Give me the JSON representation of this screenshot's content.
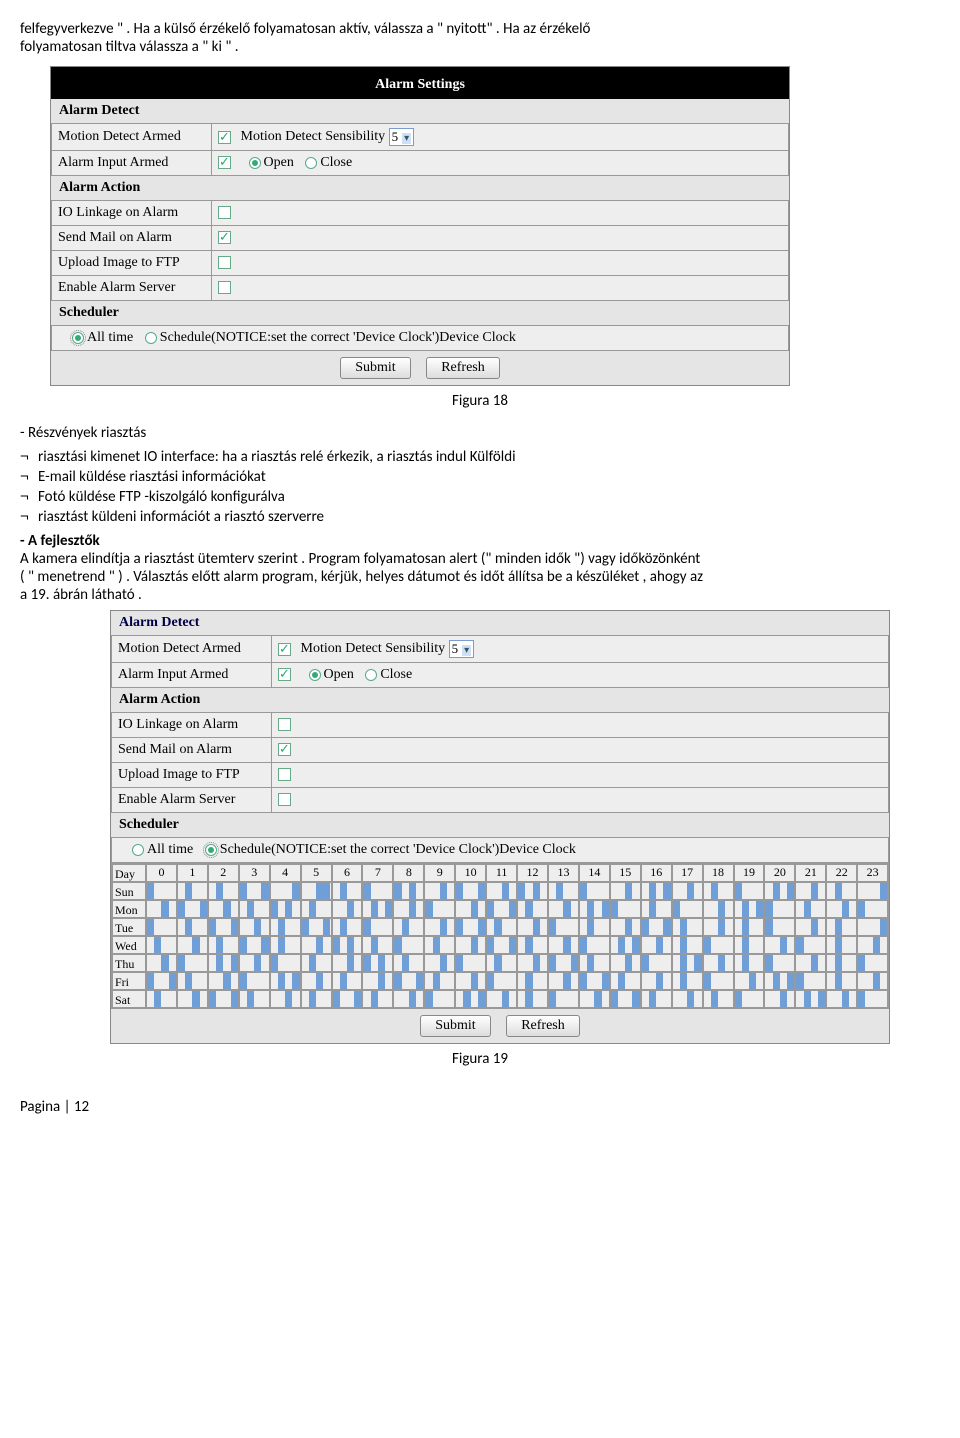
{
  "intro": {
    "line1a": "felfegyverkezve \" . Ha a külső érzékelő folyamatosan aktív, válassza a \" nyitott\" . Ha az érzékelő",
    "line1b": "folyamatosan tiltva válassza a \" ki \" ."
  },
  "panel1": {
    "title": "Alarm Settings",
    "alarm_detect_title": "Alarm Detect",
    "motion_detect_armed": "Motion Detect Armed",
    "motion_sensibility": "Motion Detect Sensibility",
    "sensibility_value": "5",
    "alarm_input_armed": "Alarm Input Armed",
    "open": "Open",
    "close": "Close",
    "alarm_action_title": "Alarm Action",
    "io_linkage": "IO Linkage on Alarm",
    "send_mail": "Send Mail on Alarm",
    "upload_ftp": "Upload Image to FTP",
    "enable_server": "Enable Alarm Server",
    "scheduler": "Scheduler",
    "all_time": "All time",
    "schedule_notice": "Schedule(NOTICE:set the correct 'Device Clock')Device Clock",
    "submit": "Submit",
    "refresh": "Refresh"
  },
  "caption1": "Figura 18",
  "section_title": "- Részvények riasztás",
  "bullets": {
    "b1": "riasztási kimenet IO interface: ha a riasztás relé érkezik, a riasztás indul Külföldi",
    "b2": "E-mail küldése riasztási információkat",
    "b3": "Fotó küldése FTP -kiszolgáló konfigurálva",
    "b4": "riasztást küldeni információt a riasztó szerverre"
  },
  "dev_title": "- A fejlesztők",
  "para2": {
    "l1": "A kamera elindítja a riasztást ütemterv szerint . Program folyamatosan alert (\" minden idők \") vagy időközönként",
    "l2": "( \" menetrend \" ) . Választás előtt alarm program, kérjük, helyes dátumot és időt állítsa be a készüléket , ahogy az",
    "l3": "a 19. ábrán látható ."
  },
  "panel2": {
    "alarm_detect_title": "Alarm Detect",
    "motion_detect_armed": "Motion Detect Armed",
    "motion_sensibility": "Motion Detect Sensibility",
    "sensibility_value": "5",
    "alarm_input_armed": "Alarm Input Armed",
    "open": "Open",
    "close": "Close",
    "alarm_action_title": "Alarm Action",
    "io_linkage": "IO Linkage on Alarm",
    "send_mail": "Send Mail on Alarm",
    "upload_ftp": "Upload Image to FTP",
    "enable_server": "Enable Alarm Server",
    "scheduler": "Scheduler",
    "all_time": "All time",
    "schedule_notice": "Schedule(NOTICE:set the correct 'Device Clock')Device Clock",
    "day_label": "Day",
    "hours": [
      "0",
      "1",
      "2",
      "3",
      "4",
      "5",
      "6",
      "7",
      "8",
      "9",
      "10",
      "11",
      "12",
      "13",
      "14",
      "15",
      "16",
      "17",
      "18",
      "19",
      "20",
      "21",
      "22",
      "23"
    ],
    "days": [
      "Sun",
      "Mon",
      "Tue",
      "Wed",
      "Thu",
      "Fri",
      "Sat"
    ],
    "submit": "Submit",
    "refresh": "Refresh"
  },
  "caption2": "Figura 19",
  "footer": "Pagina | 12",
  "chart_data": {
    "type": "table",
    "note": "Approximate scheduler pattern (4 quarter-hour segments per hour, 1=on).",
    "hours": [
      "0",
      "1",
      "2",
      "3",
      "4",
      "5",
      "6",
      "7",
      "8",
      "9",
      "10",
      "11",
      "12",
      "13",
      "14",
      "15",
      "16",
      "17",
      "18",
      "19",
      "20",
      "21",
      "22",
      "23"
    ],
    "days": [
      "Sun",
      "Mon",
      "Tue",
      "Wed",
      "Thu",
      "Fri",
      "Sat"
    ],
    "pattern": {
      "Sun": [
        [
          1,
          0,
          0,
          0
        ],
        [
          0,
          1,
          0,
          0
        ],
        [
          0,
          1,
          0,
          0
        ],
        [
          1,
          0,
          0,
          1
        ],
        [
          0,
          0,
          0,
          1
        ],
        [
          0,
          0,
          1,
          1
        ],
        [
          0,
          1,
          0,
          0
        ],
        [
          1,
          0,
          0,
          0
        ],
        [
          1,
          0,
          1,
          0
        ],
        [
          0,
          0,
          1,
          0
        ],
        [
          1,
          0,
          0,
          1
        ],
        [
          0,
          0,
          1,
          0
        ],
        [
          1,
          0,
          1,
          0
        ],
        [
          0,
          1,
          0,
          0
        ],
        [
          1,
          0,
          0,
          0
        ],
        [
          0,
          0,
          1,
          0
        ],
        [
          0,
          1,
          0,
          1
        ],
        [
          0,
          0,
          1,
          0
        ],
        [
          0,
          1,
          0,
          0
        ],
        [
          1,
          0,
          0,
          0
        ],
        [
          0,
          1,
          0,
          1
        ],
        [
          0,
          0,
          1,
          0
        ],
        [
          0,
          1,
          0,
          0
        ],
        [
          0,
          0,
          0,
          1
        ]
      ],
      "Mon": [
        [
          0,
          0,
          1,
          0
        ],
        [
          1,
          0,
          0,
          1
        ],
        [
          0,
          0,
          1,
          0
        ],
        [
          0,
          1,
          0,
          0
        ],
        [
          1,
          0,
          1,
          0
        ],
        [
          0,
          1,
          0,
          0
        ],
        [
          0,
          0,
          1,
          0
        ],
        [
          0,
          1,
          0,
          1
        ],
        [
          0,
          0,
          1,
          0
        ],
        [
          1,
          0,
          0,
          0
        ],
        [
          0,
          0,
          1,
          0
        ],
        [
          1,
          0,
          0,
          1
        ],
        [
          0,
          1,
          0,
          0
        ],
        [
          0,
          0,
          1,
          0
        ],
        [
          0,
          1,
          0,
          1
        ],
        [
          1,
          0,
          0,
          0
        ],
        [
          0,
          1,
          0,
          0
        ],
        [
          1,
          0,
          0,
          0
        ],
        [
          0,
          0,
          1,
          0
        ],
        [
          0,
          1,
          0,
          1
        ],
        [
          1,
          0,
          0,
          0
        ],
        [
          0,
          1,
          0,
          0
        ],
        [
          0,
          0,
          1,
          0
        ],
        [
          1,
          0,
          0,
          0
        ]
      ],
      "Tue": [
        [
          1,
          0,
          0,
          0
        ],
        [
          0,
          1,
          0,
          0
        ],
        [
          1,
          0,
          0,
          1
        ],
        [
          0,
          0,
          1,
          0
        ],
        [
          0,
          1,
          0,
          0
        ],
        [
          1,
          0,
          0,
          1
        ],
        [
          0,
          1,
          0,
          0
        ],
        [
          1,
          0,
          0,
          0
        ],
        [
          0,
          1,
          0,
          0
        ],
        [
          0,
          0,
          1,
          0
        ],
        [
          1,
          0,
          0,
          1
        ],
        [
          0,
          1,
          0,
          0
        ],
        [
          0,
          0,
          1,
          0
        ],
        [
          1,
          0,
          0,
          0
        ],
        [
          0,
          1,
          0,
          0
        ],
        [
          0,
          0,
          1,
          0
        ],
        [
          1,
          0,
          0,
          1
        ],
        [
          0,
          1,
          0,
          0
        ],
        [
          0,
          0,
          1,
          0
        ],
        [
          0,
          1,
          0,
          0
        ],
        [
          1,
          0,
          0,
          0
        ],
        [
          0,
          0,
          1,
          0
        ],
        [
          0,
          1,
          0,
          0
        ],
        [
          0,
          0,
          0,
          1
        ]
      ],
      "Wed": [
        [
          0,
          1,
          0,
          0
        ],
        [
          0,
          0,
          1,
          0
        ],
        [
          0,
          1,
          0,
          0
        ],
        [
          1,
          0,
          0,
          1
        ],
        [
          0,
          1,
          0,
          0
        ],
        [
          0,
          0,
          1,
          0
        ],
        [
          1,
          0,
          1,
          0
        ],
        [
          0,
          1,
          0,
          0
        ],
        [
          1,
          0,
          0,
          0
        ],
        [
          0,
          1,
          0,
          0
        ],
        [
          0,
          0,
          1,
          0
        ],
        [
          1,
          0,
          0,
          1
        ],
        [
          0,
          1,
          0,
          0
        ],
        [
          0,
          0,
          1,
          0
        ],
        [
          1,
          0,
          0,
          0
        ],
        [
          0,
          1,
          0,
          1
        ],
        [
          0,
          0,
          1,
          0
        ],
        [
          0,
          1,
          0,
          0
        ],
        [
          1,
          0,
          0,
          0
        ],
        [
          0,
          1,
          0,
          0
        ],
        [
          0,
          0,
          1,
          0
        ],
        [
          1,
          0,
          0,
          0
        ],
        [
          0,
          1,
          0,
          0
        ],
        [
          0,
          0,
          1,
          0
        ]
      ],
      "Thu": [
        [
          0,
          0,
          1,
          0
        ],
        [
          1,
          0,
          0,
          0
        ],
        [
          0,
          1,
          0,
          1
        ],
        [
          0,
          0,
          1,
          0
        ],
        [
          1,
          0,
          0,
          0
        ],
        [
          0,
          1,
          0,
          0
        ],
        [
          0,
          0,
          1,
          0
        ],
        [
          1,
          0,
          1,
          0
        ],
        [
          0,
          1,
          0,
          0
        ],
        [
          0,
          0,
          1,
          0
        ],
        [
          1,
          0,
          0,
          0
        ],
        [
          0,
          1,
          0,
          0
        ],
        [
          0,
          0,
          1,
          0
        ],
        [
          1,
          0,
          0,
          1
        ],
        [
          0,
          1,
          0,
          0
        ],
        [
          0,
          0,
          1,
          0
        ],
        [
          1,
          0,
          0,
          0
        ],
        [
          0,
          1,
          0,
          1
        ],
        [
          0,
          0,
          1,
          0
        ],
        [
          0,
          1,
          0,
          0
        ],
        [
          1,
          0,
          0,
          0
        ],
        [
          0,
          0,
          1,
          0
        ],
        [
          0,
          1,
          0,
          0
        ],
        [
          1,
          0,
          0,
          0
        ]
      ],
      "Fri": [
        [
          1,
          0,
          0,
          1
        ],
        [
          0,
          1,
          0,
          0
        ],
        [
          0,
          0,
          1,
          0
        ],
        [
          1,
          0,
          0,
          0
        ],
        [
          0,
          1,
          0,
          1
        ],
        [
          0,
          0,
          1,
          0
        ],
        [
          0,
          1,
          0,
          0
        ],
        [
          0,
          0,
          1,
          0
        ],
        [
          1,
          0,
          0,
          1
        ],
        [
          0,
          1,
          0,
          0
        ],
        [
          0,
          0,
          1,
          0
        ],
        [
          1,
          0,
          0,
          0
        ],
        [
          0,
          1,
          0,
          0
        ],
        [
          0,
          0,
          1,
          0
        ],
        [
          1,
          0,
          0,
          1
        ],
        [
          0,
          1,
          0,
          0
        ],
        [
          0,
          0,
          1,
          0
        ],
        [
          0,
          1,
          0,
          0
        ],
        [
          1,
          0,
          0,
          0
        ],
        [
          0,
          0,
          1,
          0
        ],
        [
          0,
          1,
          0,
          1
        ],
        [
          1,
          0,
          0,
          0
        ],
        [
          0,
          1,
          0,
          0
        ],
        [
          0,
          0,
          1,
          0
        ]
      ],
      "Sat": [
        [
          0,
          1,
          0,
          0
        ],
        [
          0,
          0,
          1,
          0
        ],
        [
          1,
          0,
          0,
          1
        ],
        [
          0,
          1,
          0,
          0
        ],
        [
          0,
          0,
          1,
          0
        ],
        [
          0,
          1,
          0,
          0
        ],
        [
          1,
          0,
          0,
          1
        ],
        [
          0,
          1,
          0,
          0
        ],
        [
          0,
          0,
          1,
          0
        ],
        [
          1,
          0,
          0,
          0
        ],
        [
          0,
          1,
          0,
          1
        ],
        [
          0,
          0,
          1,
          0
        ],
        [
          0,
          1,
          0,
          0
        ],
        [
          1,
          0,
          0,
          0
        ],
        [
          0,
          0,
          1,
          0
        ],
        [
          1,
          0,
          0,
          1
        ],
        [
          0,
          1,
          0,
          0
        ],
        [
          0,
          0,
          1,
          0
        ],
        [
          0,
          1,
          0,
          0
        ],
        [
          1,
          0,
          0,
          0
        ],
        [
          0,
          0,
          1,
          0
        ],
        [
          0,
          1,
          0,
          1
        ],
        [
          0,
          0,
          1,
          0
        ],
        [
          1,
          0,
          0,
          0
        ]
      ]
    }
  }
}
